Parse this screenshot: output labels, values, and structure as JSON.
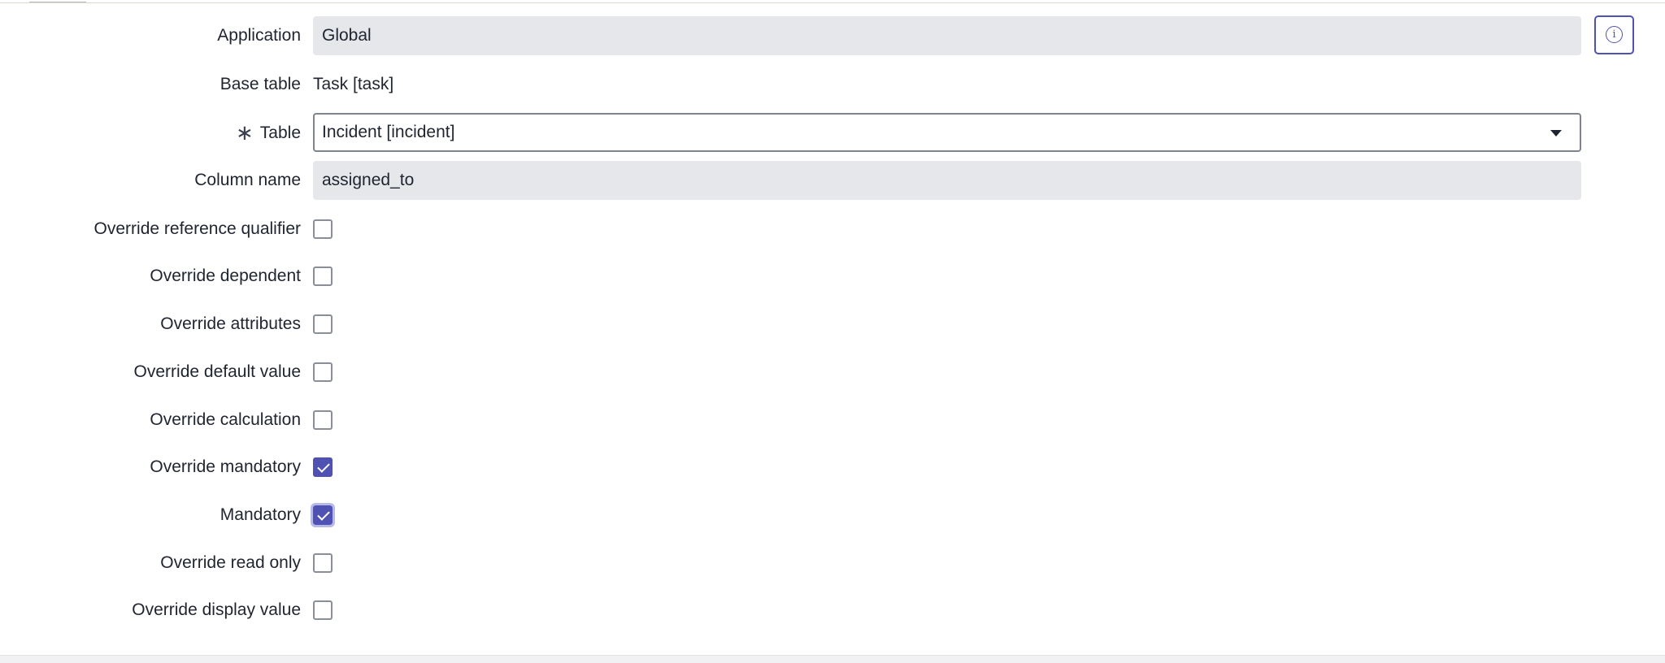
{
  "form": {
    "application": {
      "label": "Application",
      "value": "Global"
    },
    "base_table": {
      "label": "Base table",
      "value": "Task [task]"
    },
    "table": {
      "label": "Table",
      "required_marker": "∗",
      "value": "Incident [incident]"
    },
    "column_name": {
      "label": "Column name",
      "value": "assigned_to"
    },
    "checkboxes": [
      {
        "label": "Override reference qualifier",
        "checked": false
      },
      {
        "label": "Override dependent",
        "checked": false
      },
      {
        "label": "Override attributes",
        "checked": false
      },
      {
        "label": "Override default value",
        "checked": false
      },
      {
        "label": "Override calculation",
        "checked": false
      },
      {
        "label": "Override mandatory",
        "checked": true
      },
      {
        "label": "Mandatory",
        "checked": true,
        "focused": true
      },
      {
        "label": "Override read only",
        "checked": false
      },
      {
        "label": "Override display value",
        "checked": false
      }
    ]
  },
  "icons": {
    "info": "info-icon",
    "dropdown": "chevron-down-icon",
    "check": "checkmark-icon"
  },
  "colors": {
    "accent": "#4f52b2",
    "readonly_bg": "#e6e7ea",
    "text": "#1f2430"
  }
}
